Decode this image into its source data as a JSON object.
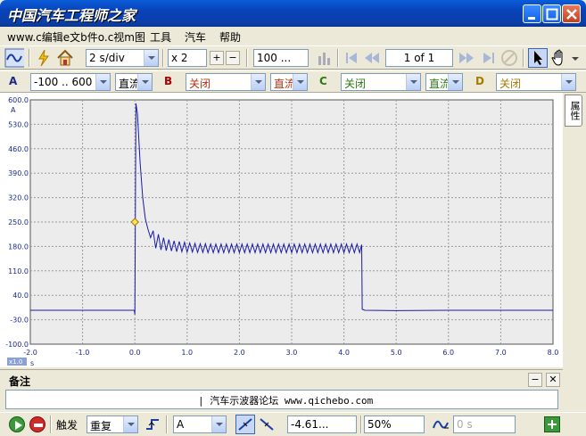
{
  "window": {
    "title": "中国汽车工程师之家"
  },
  "menu": {
    "items": [
      "www.c编辑e文b件o.c视m图",
      "工具",
      "汽车",
      "帮助"
    ]
  },
  "toolbar1": {
    "timebase": "2 s/div",
    "zoom": "x 2",
    "samples": "100 ...",
    "page_indicator": "1 of 1"
  },
  "toolbar2": {
    "channel_a": {
      "letter": "A",
      "range": "-100 .. 600 A",
      "coupling": "直流"
    },
    "channel_b": {
      "letter": "B",
      "range": "关闭",
      "coupling": "直流"
    },
    "channel_c": {
      "letter": "C",
      "range": "关闭",
      "coupling": "直流"
    },
    "channel_d": {
      "letter": "D",
      "range": "关闭"
    }
  },
  "side_tab": {
    "label": "属性"
  },
  "chart_data": {
    "type": "line",
    "xlabel": "",
    "x_unit": "s",
    "y_unit": "A",
    "xlim": [
      -2.0,
      8.0
    ],
    "ylim": [
      -100.0,
      600.0
    ],
    "grid": true,
    "x_ticks": [
      "-2.0",
      "-1.0",
      "0.0",
      "1.0",
      "2.0",
      "3.0",
      "4.0",
      "5.0",
      "6.0",
      "7.0",
      "8.0"
    ],
    "y_ticks": [
      "600.0",
      "530.0",
      "460.0",
      "390.0",
      "320.0",
      "250.0",
      "180.0",
      "110.0",
      "40.0",
      "-30.0",
      "-100.0"
    ],
    "x_scale_label": "x1.0",
    "trigger_marker": {
      "x": 0.0,
      "y": 250.0
    },
    "series": [
      {
        "color": "#1a1aa8",
        "points": [
          [
            -2.0,
            -3
          ],
          [
            -0.01,
            -3
          ],
          [
            0.0,
            -15
          ],
          [
            0.02,
            590
          ],
          [
            0.05,
            560
          ],
          [
            0.1,
            420
          ],
          [
            0.15,
            320
          ],
          [
            0.2,
            260
          ],
          [
            0.25,
            230
          ],
          [
            0.3,
            205
          ],
          [
            0.35,
            225
          ],
          [
            0.4,
            175
          ],
          [
            0.45,
            215
          ],
          [
            0.5,
            170
          ],
          [
            0.55,
            205
          ],
          [
            0.6,
            168
          ],
          [
            0.65,
            200
          ],
          [
            0.7,
            167
          ],
          [
            0.75,
            196
          ],
          [
            0.8,
            165
          ],
          [
            0.85,
            194
          ],
          [
            0.9,
            165
          ],
          [
            0.95,
            192
          ],
          [
            1.0,
            164
          ],
          [
            1.05,
            190
          ],
          [
            1.1,
            164
          ],
          [
            1.15,
            189
          ],
          [
            1.2,
            163
          ],
          [
            1.25,
            188
          ],
          [
            1.3,
            163
          ],
          [
            1.35,
            188
          ],
          [
            1.4,
            162
          ],
          [
            1.45,
            187
          ],
          [
            1.5,
            162
          ],
          [
            1.55,
            187
          ],
          [
            1.6,
            162
          ],
          [
            1.65,
            187
          ],
          [
            1.7,
            162
          ],
          [
            1.75,
            187
          ],
          [
            1.8,
            162
          ],
          [
            1.85,
            187
          ],
          [
            1.9,
            162
          ],
          [
            1.95,
            187
          ],
          [
            2.0,
            162
          ],
          [
            2.05,
            187
          ],
          [
            2.1,
            162
          ],
          [
            2.15,
            187
          ],
          [
            2.2,
            162
          ],
          [
            2.25,
            187
          ],
          [
            2.3,
            162
          ],
          [
            2.35,
            187
          ],
          [
            2.4,
            162
          ],
          [
            2.45,
            187
          ],
          [
            2.5,
            162
          ],
          [
            2.55,
            187
          ],
          [
            2.6,
            162
          ],
          [
            2.65,
            187
          ],
          [
            2.7,
            162
          ],
          [
            2.75,
            187
          ],
          [
            2.8,
            162
          ],
          [
            2.85,
            187
          ],
          [
            2.9,
            162
          ],
          [
            2.95,
            187
          ],
          [
            3.0,
            162
          ],
          [
            3.05,
            187
          ],
          [
            3.1,
            162
          ],
          [
            3.15,
            187
          ],
          [
            3.2,
            162
          ],
          [
            3.25,
            187
          ],
          [
            3.3,
            162
          ],
          [
            3.35,
            187
          ],
          [
            3.4,
            162
          ],
          [
            3.45,
            187
          ],
          [
            3.5,
            162
          ],
          [
            3.55,
            187
          ],
          [
            3.6,
            162
          ],
          [
            3.65,
            187
          ],
          [
            3.7,
            162
          ],
          [
            3.75,
            187
          ],
          [
            3.8,
            162
          ],
          [
            3.85,
            187
          ],
          [
            3.9,
            162
          ],
          [
            3.95,
            187
          ],
          [
            4.0,
            162
          ],
          [
            4.05,
            187
          ],
          [
            4.1,
            162
          ],
          [
            4.15,
            187
          ],
          [
            4.2,
            162
          ],
          [
            4.25,
            187
          ],
          [
            4.3,
            162
          ],
          [
            4.34,
            185
          ],
          [
            4.35,
            0
          ],
          [
            4.4,
            -3
          ],
          [
            5.0,
            -4
          ],
          [
            6.0,
            -3
          ],
          [
            7.0,
            -3
          ],
          [
            8.0,
            -3
          ]
        ]
      }
    ]
  },
  "notes": {
    "title": "备注",
    "text": "|  汽车示波器论坛  www.qichebo.com"
  },
  "statusbar": {
    "trigger_label": "触发",
    "trigger_mode": "重复",
    "trigger_channel": "A",
    "trigger_level": "-4.61...",
    "pretrigger": "50%",
    "delay": "0 s"
  }
}
